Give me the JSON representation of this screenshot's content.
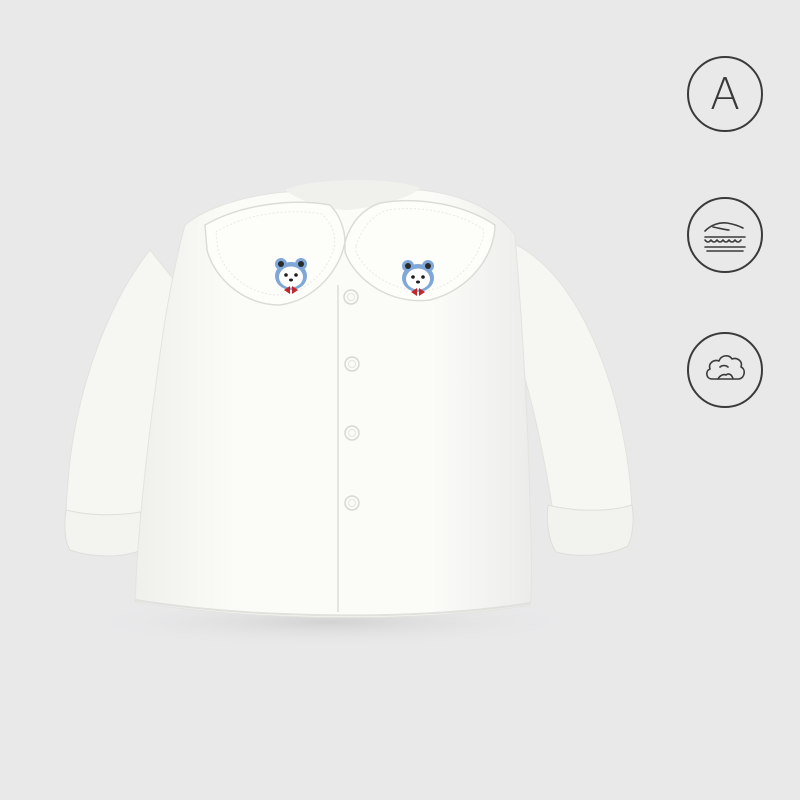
{
  "badges": {
    "grade": {
      "letter": "A",
      "icon": "letter-a-icon"
    },
    "softness": {
      "icon": "hand-on-cushion-icon"
    },
    "cotton": {
      "icon": "cotton-cloud-icon"
    }
  },
  "colors": {
    "background": "#e9e9ea",
    "shirt": "#fbfbf8",
    "icon_stroke": "#3a3a3a",
    "embroidery_blue": "#7fa8d8",
    "embroidery_red": "#c3262b"
  }
}
